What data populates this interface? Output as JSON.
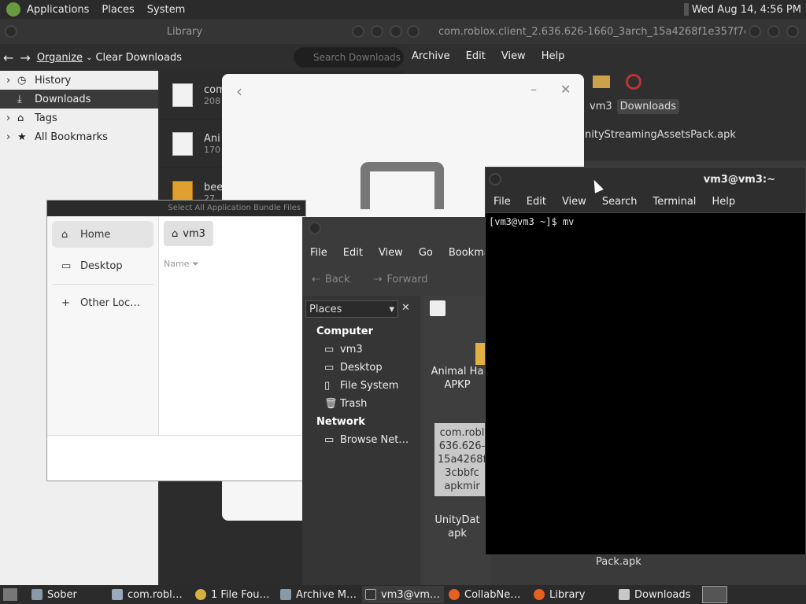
{
  "top_panel": {
    "applications": "Applications",
    "places": "Places",
    "system": "System",
    "clock": "Wed Aug 14,  4:56 PM"
  },
  "library": {
    "title": "Library",
    "organize": "Organize",
    "clear_downloads": "Clear Downloads",
    "search_placeholder": "Search Downloads",
    "sidebar": [
      "History",
      "Downloads",
      "Tags",
      "All Bookmarks"
    ],
    "downloads": [
      {
        "name": "com",
        "meta": "208"
      },
      {
        "name": "Ani",
        "meta": "170"
      },
      {
        "name": "bee",
        "meta": "27"
      }
    ]
  },
  "archive": {
    "title": "com.roblox.client_2.636.626-1660_3arch_15a4268f1e357f7e...",
    "menu": [
      "Archive",
      "Edit",
      "View",
      "Help"
    ],
    "path": [
      "vm3",
      "Downloads"
    ],
    "file": "nityStreamingAssetsPack.apk"
  },
  "select_dialog": {
    "title": "Select All Application Bundle Files",
    "places": [
      "Home",
      "Desktop",
      "Other Loc…"
    ],
    "path_button": "vm3",
    "column_name": "Name"
  },
  "caja": {
    "menu": [
      "File",
      "Edit",
      "View",
      "Go",
      "Bookma"
    ],
    "back": "Back",
    "forward": "Forward",
    "places_label": "Places",
    "computer": "Computer",
    "computer_items": [
      "vm3",
      "Desktop",
      "File System",
      "Trash"
    ],
    "network": "Network",
    "network_items": [
      "Browse Net…"
    ],
    "icons": [
      {
        "label": "Animal Ha\nAPKP"
      },
      {
        "label": "com.robl\n636.626-\n15a4268f\n3cbbfc\napkmir"
      },
      {
        "label": "UnityDat\napk"
      }
    ],
    "extra_label": "Pack.apk"
  },
  "terminal": {
    "title": "vm3@vm3:~",
    "menu": [
      "File",
      "Edit",
      "View",
      "Search",
      "Terminal",
      "Help"
    ],
    "prompt": "[vm3@vm3 ~]$ mv"
  },
  "taskbar": [
    {
      "label": "Sober",
      "color": "#8899aa"
    },
    {
      "label": "com.robl…",
      "color": "#99aabb"
    },
    {
      "label": "1 File Fou…",
      "color": "#d8b040"
    },
    {
      "label": "Archive M…",
      "color": "#8899aa"
    },
    {
      "label": "vm3@vm…",
      "color": "#333333"
    },
    {
      "label": "CollabNe…",
      "color": "#e66020"
    },
    {
      "label": "Library",
      "color": "#e66020"
    },
    {
      "label": "Downloads",
      "color": "#c8c8c8"
    }
  ]
}
